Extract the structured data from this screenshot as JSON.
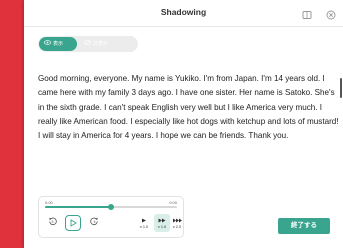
{
  "window": {
    "title": "Shadowing"
  },
  "toggle": {
    "show_label": "表示",
    "hide_label": "非表示"
  },
  "passage": {
    "text": "Good morning, everyone. My name is Yukiko. I'm from Japan. I'm 14 years old. I came here with my family 3 days ago. I have one sister. Her name is Satoko. She's in the sixth grade. I can't speak English very well but I like America very much. I really like American food. I especially like hot dogs with ketchup and lots of mustard! I will stay in America for 4 years. I hope we can be friends. Thank you."
  },
  "player": {
    "current_time": "0:00",
    "total_time": "0:00",
    "progress": 0.5,
    "speeds": [
      {
        "label": "x 1.0"
      },
      {
        "label": "x 1.5"
      },
      {
        "label": "x 2.0"
      }
    ]
  },
  "finish_button": {
    "label": "終了する"
  },
  "colors": {
    "accent": "#3aa58e",
    "background": "#e0323c"
  },
  "icons": [
    "book-icon",
    "close-icon",
    "eye-icon",
    "eye-off-icon",
    "rewind-icon",
    "play-icon",
    "forward-icon",
    "speed-icon"
  ]
}
